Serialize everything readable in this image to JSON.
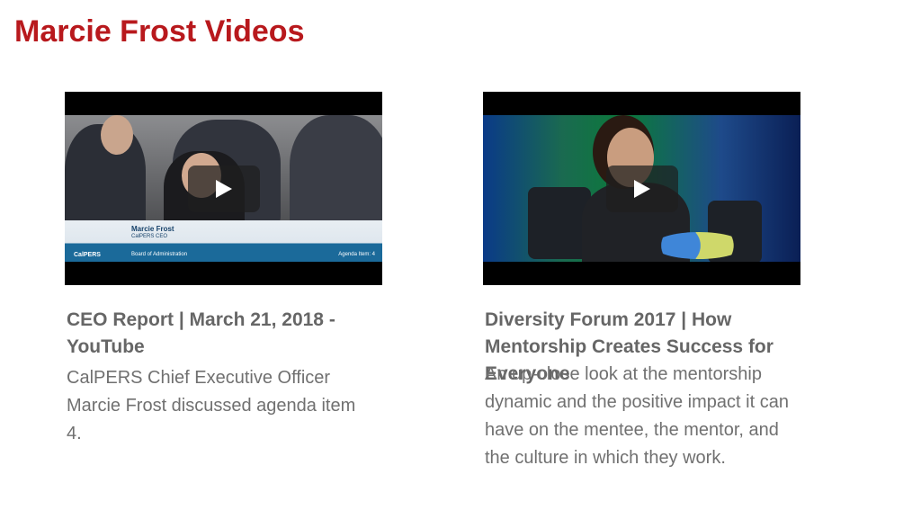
{
  "page": {
    "title": "Marcie Frost Videos",
    "title_color": "#b8191d"
  },
  "videos": [
    {
      "title": "CEO Report | March 21, 2018 - YouTube",
      "description": "CalPERS Chief Executive Officer Marcie Frost discussed agenda item 4.",
      "overlay": {
        "name": "Marcie Frost",
        "role": "CalPERS CEO",
        "logo": "CalPERS",
        "board": "Board of Administration",
        "agenda": "Agenda Item: 4"
      },
      "play_icon": "play-icon"
    },
    {
      "title": "Diversity Forum 2017 | How Mentorship Creates Success for Everyone",
      "description": "An up-close look at the mentorship dynamic and the positive impact it can have on the mentee, the mentor, and the culture in which they work.",
      "play_icon": "play-icon"
    }
  ]
}
